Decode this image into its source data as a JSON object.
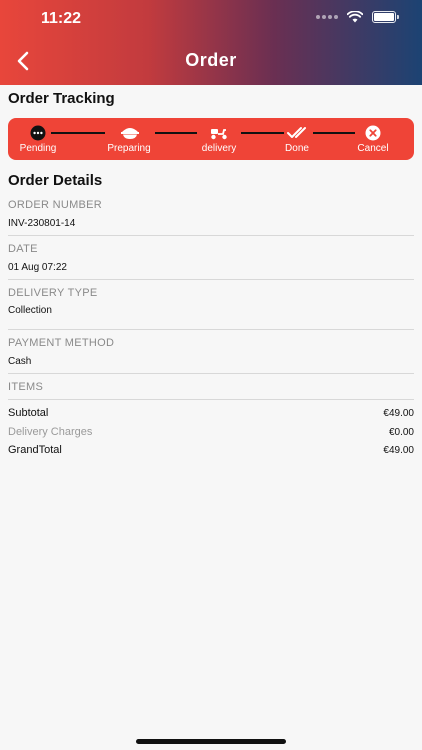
{
  "status_bar": {
    "time": "11:22"
  },
  "header": {
    "title": "Order",
    "back_icon": "chevron-left-icon"
  },
  "tracking": {
    "title": "Order Tracking",
    "accent_color": "#ef4437",
    "steps": [
      {
        "label": "Pending",
        "icon": "more-dots-icon"
      },
      {
        "label": "Preparing",
        "icon": "cooking-pot-icon"
      },
      {
        "label": "delivery",
        "icon": "scooter-icon"
      },
      {
        "label": "Done",
        "icon": "double-check-icon"
      },
      {
        "label": "Cancel",
        "icon": "close-circle-icon"
      }
    ]
  },
  "details": {
    "title": "Order Details",
    "order_number_label": "ORDER NUMBER",
    "order_number": "INV-230801-14",
    "date_label": "DATE",
    "date": "01 Aug 07:22",
    "delivery_type_label": "DELIVERY TYPE",
    "delivery_type": "Collection",
    "payment_method_label": "PAYMENT METHOD",
    "payment_method": "Cash",
    "items_label": "ITEMS"
  },
  "summary": {
    "subtotal_label": "Subtotal",
    "subtotal": "€49.00",
    "delivery_label": "Delivery Charges",
    "delivery": "€0.00",
    "grand_label": "GrandTotal",
    "grand": "€49.00"
  }
}
